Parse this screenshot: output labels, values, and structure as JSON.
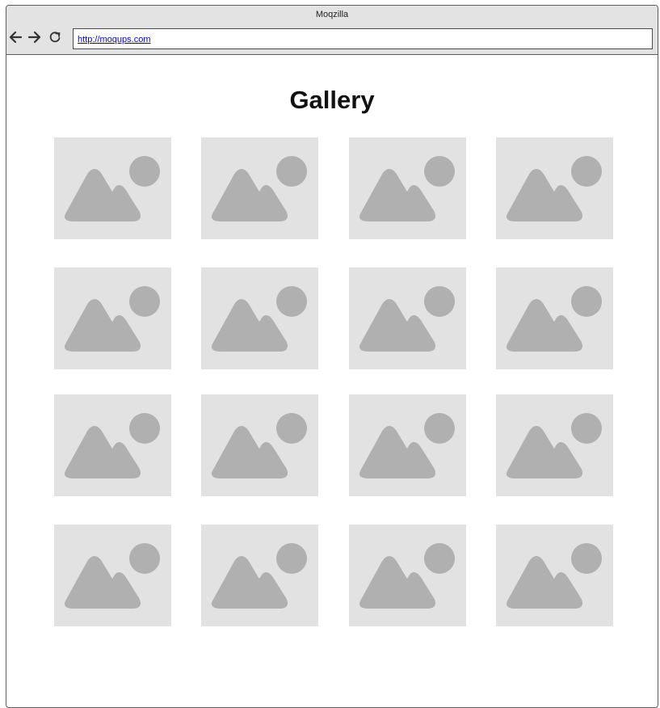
{
  "window": {
    "title": "Moqzilla"
  },
  "toolbar": {
    "back_icon": "arrow-left-icon",
    "forward_icon": "arrow-right-icon",
    "reload_icon": "reload-icon"
  },
  "address_bar": {
    "url": "http://moqups.com"
  },
  "page": {
    "title": "Gallery"
  },
  "gallery": {
    "rows": 4,
    "columns": 4,
    "placeholder_icon": "image-placeholder-icon",
    "colors": {
      "tile_background": "#e2e2e2",
      "icon": "#b0b0b0"
    }
  }
}
